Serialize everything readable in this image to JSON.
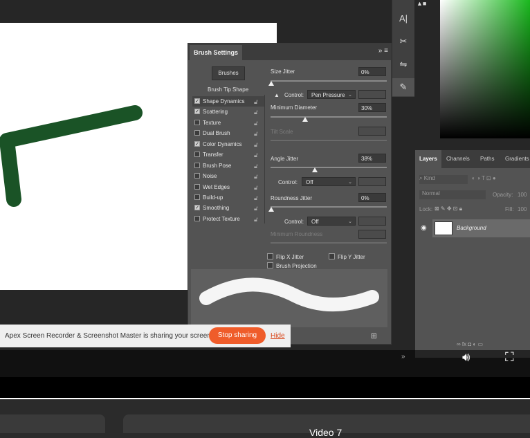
{
  "colors": {
    "accent": "#ef5c2a",
    "brush_stroke": "#0e4a1a",
    "panel": "#535353",
    "color_field": "#1ab81e"
  },
  "brush_settings": {
    "tab_title": "Brush Settings",
    "brushes_button": "Brushes",
    "brush_tip_shape": "Brush Tip Shape",
    "options": [
      {
        "label": "Shape Dynamics",
        "checked": true
      },
      {
        "label": "Scattering",
        "checked": true
      },
      {
        "label": "Texture",
        "checked": false
      },
      {
        "label": "Dual Brush",
        "checked": false
      },
      {
        "label": "Color Dynamics",
        "checked": true
      },
      {
        "label": "Transfer",
        "checked": false
      },
      {
        "label": "Brush Pose",
        "checked": false
      },
      {
        "label": "Noise",
        "checked": false
      },
      {
        "label": "Wet Edges",
        "checked": false
      },
      {
        "label": "Build-up",
        "checked": false
      },
      {
        "label": "Smoothing",
        "checked": true
      },
      {
        "label": "Protect Texture",
        "checked": false
      }
    ],
    "size_jitter": {
      "label": "Size Jitter",
      "value": "0%"
    },
    "control1": {
      "label": "Control:",
      "value": "Pen Pressure"
    },
    "minimum_diameter": {
      "label": "Minimum Diameter",
      "value": "30%"
    },
    "tilt_scale": {
      "label": "Tilt Scale"
    },
    "angle_jitter": {
      "label": "Angle Jitter",
      "value": "38%"
    },
    "control2": {
      "label": "Control:",
      "value": "Off"
    },
    "roundness_jitter": {
      "label": "Roundness Jitter",
      "value": "0%"
    },
    "control3": {
      "label": "Control:",
      "value": "Off"
    },
    "minimum_roundness": {
      "label": "Minimum Roundness"
    },
    "flip_x": "Flip X Jitter",
    "flip_y": "Flip Y Jitter",
    "brush_projection": "Brush Projection"
  },
  "layers": {
    "tabs": [
      "Layers",
      "Channels",
      "Paths",
      "Gradients"
    ],
    "kind": "Kind",
    "blend": "Normal",
    "opacity_label": "Opacity:",
    "opacity_value": "100",
    "lock_label": "Lock:",
    "fill_label": "Fill:",
    "fill_value": "100",
    "layer_name": "Background"
  },
  "share": {
    "message": "Apex Screen Recorder & Screenshot Master is sharing your screen.",
    "stop": "Stop sharing",
    "hide": "Hide"
  },
  "below": {
    "title": "Video 7"
  }
}
